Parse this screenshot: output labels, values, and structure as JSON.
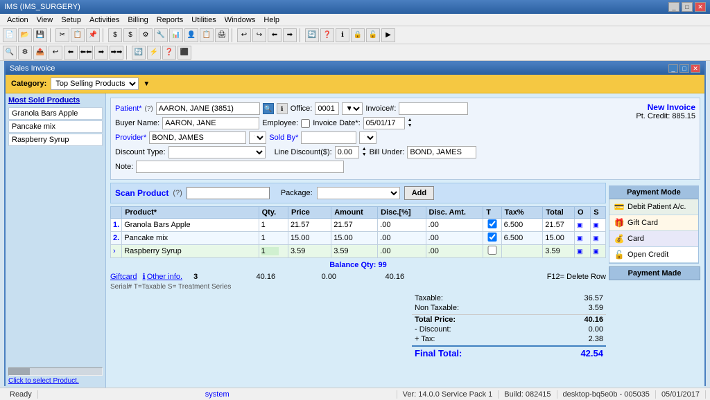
{
  "titlebar": {
    "title": "IMS (IMS_SURGERY)",
    "controls": [
      "_",
      "□",
      "✕"
    ]
  },
  "menubar": {
    "items": [
      "Action",
      "View",
      "Setup",
      "Activities",
      "Billing",
      "Reports",
      "Utilities",
      "Windows",
      "Help"
    ]
  },
  "statusbar": {
    "status": "Ready",
    "system": "system",
    "version": "Ver: 14.0.0 Service Pack 1",
    "build": "Build: 082415",
    "machine": "desktop-bq5e0b - 005035",
    "date": "05/01/2017"
  },
  "window": {
    "title": "Sales Invoice",
    "category_label": "Category:",
    "category_value": "Top Selling Products"
  },
  "left_panel": {
    "title": "Most Sold Products",
    "items": [
      "Granola Bars Apple",
      "Pancake mix",
      "Raspberry Syrup"
    ]
  },
  "invoice": {
    "patient_label": "Patient*",
    "patient_code": "(?) AARON, JANE (3851)",
    "office_label": "Office:",
    "office_value": "0001",
    "invoice_label": "Invoice#:",
    "invoice_value": "",
    "new_invoice": "New Invoice",
    "pt_credit_label": "Pt. Credit:",
    "pt_credit_value": "885.15",
    "buyer_label": "Buyer Name:",
    "buyer_value": "AARON, JANE",
    "employee_label": "Employee:",
    "invoice_date_label": "Invoice Date*:",
    "invoice_date_value": "05/01/17",
    "provider_label": "Provider*",
    "provider_value": "BOND, JAMES",
    "sold_by_label": "Sold By*",
    "sold_by_value": "",
    "discount_type_label": "Discount Type:",
    "discount_type_value": "",
    "line_discount_label": "Line Discount($):",
    "line_discount_value": "0.00",
    "bill_under_label": "Bill Under:",
    "bill_under_value": "BOND, JAMES",
    "note_label": "Note:"
  },
  "scan_section": {
    "label": "Scan Product",
    "question_mark": "(?)",
    "package_label": "Package:",
    "package_value": "",
    "add_btn": "Add"
  },
  "table": {
    "headers": [
      "",
      "Product*",
      "Qty.",
      "Price",
      "Amount",
      "Disc.[%]",
      "Disc. Amt.",
      "T",
      "Tax%",
      "Total",
      "O",
      "S"
    ],
    "rows": [
      {
        "num": "1.",
        "product": "Granola Bars Apple",
        "qty": "1",
        "price": "21.57",
        "amount": "21.57",
        "disc_pct": ".00",
        "disc_amt": ".00",
        "t": "",
        "tax": "6.500",
        "total": "21.57",
        "o": "",
        "s": ""
      },
      {
        "num": "2.",
        "product": "Pancake mix",
        "qty": "1",
        "price": "15.00",
        "amount": "15.00",
        "disc_pct": ".00",
        "disc_amt": ".00",
        "t": "",
        "tax": "6.500",
        "total": "15.00",
        "o": "",
        "s": ""
      },
      {
        "num": "›",
        "product": "Raspberry Syrup",
        "qty": "1",
        "price": "3.59",
        "amount": "3.59",
        "disc_pct": ".00",
        "disc_amt": ".00",
        "t": "",
        "tax": "",
        "total": "3.59",
        "o": "",
        "s": ""
      }
    ]
  },
  "bottom": {
    "balance_qty_label": "Balance Qty: 99",
    "giftcard_link": "Giftcard",
    "other_info_link": "Other info.",
    "serial_info": "Serial#   T=Taxable  S= Treatment Series",
    "qty_total": "3",
    "subtotal": "40.16",
    "discount_total": "0.00",
    "total_amount": "40.16",
    "f12_text": "F12= Delete Row",
    "taxable_label": "Taxable:",
    "taxable_value": "36.57",
    "non_taxable_label": "Non Taxable:",
    "non_taxable_value": "3.59",
    "total_price_label": "Total Price:",
    "total_price_value": "40.16",
    "discount_label": "- Discount:",
    "discount_value": "0.00",
    "tax_label": "+ Tax:",
    "tax_value": "2.38",
    "final_total_label": "Final Total:",
    "final_total_value": "42.54",
    "click_to_select": "Click to select Product."
  },
  "payment_mode": {
    "title": "Payment Mode",
    "items": [
      {
        "label": "Debit Patient A/c.",
        "icon": "💳"
      },
      {
        "label": "Gift Card",
        "icon": "🎁"
      },
      {
        "label": "Open Credit",
        "icon": ""
      }
    ],
    "payment_made_title": "Payment Made"
  },
  "card_label": "Card"
}
